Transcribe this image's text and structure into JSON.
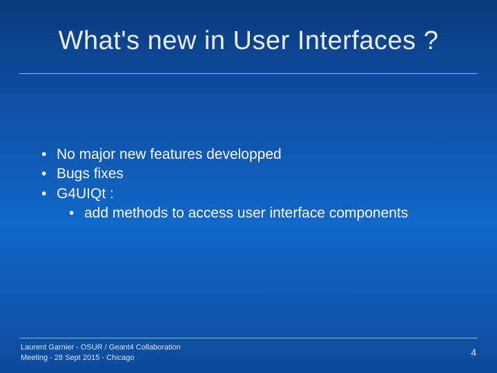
{
  "title": "What's new in User Interfaces ?",
  "bullets": {
    "item0": "No major new features developped",
    "item1": "Bugs fixes",
    "item2": " G4UIQt :",
    "sub0": " add methods to access user interface components"
  },
  "footer": {
    "line1": "Laurent Garnier - OSUR / Geant4 Collaboration",
    "line2": "Meeting - 28 Sept 2015 - Chicago"
  },
  "page_number": "4"
}
